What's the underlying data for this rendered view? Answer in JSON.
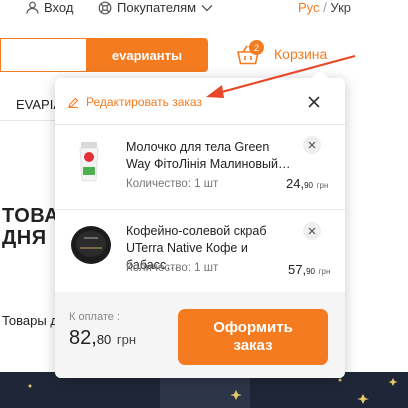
{
  "header": {
    "login_label": "Вход",
    "customers_label": "Покупателям",
    "lang_active": "Рус",
    "lang_sep": "/",
    "lang_other": "Укр"
  },
  "search": {
    "button_label": "еvарианты"
  },
  "cart": {
    "count": "2",
    "label": "Корзина"
  },
  "background": {
    "nav_fragment": "EVAPIA",
    "title_line1": "ТОВА",
    "title_line2": "ДНЯ",
    "subtitle_fragment": "Товары д"
  },
  "popup": {
    "edit_label": "Редактировать заказ",
    "items": [
      {
        "title": "Молочко для тела Green Way ФітоЛінія Малиновый…",
        "qty": "Количество: 1 шт",
        "price_main": "24,",
        "price_kop": "90",
        "currency": "грн"
      },
      {
        "title": "Кофейно-солевой скраб UTerra Native Кофе и бабасс…",
        "qty": "Количество: 1 шт",
        "price_main": "57,",
        "price_kop": "90",
        "currency": "грн"
      }
    ],
    "footer": {
      "pay_label": "К оплате :",
      "total_main": "82,",
      "total_kop": "80",
      "total_currency": "грн",
      "checkout_label": "Оформить заказ"
    }
  },
  "colors": {
    "accent": "#f47b20",
    "arrow": "#e8472a"
  }
}
